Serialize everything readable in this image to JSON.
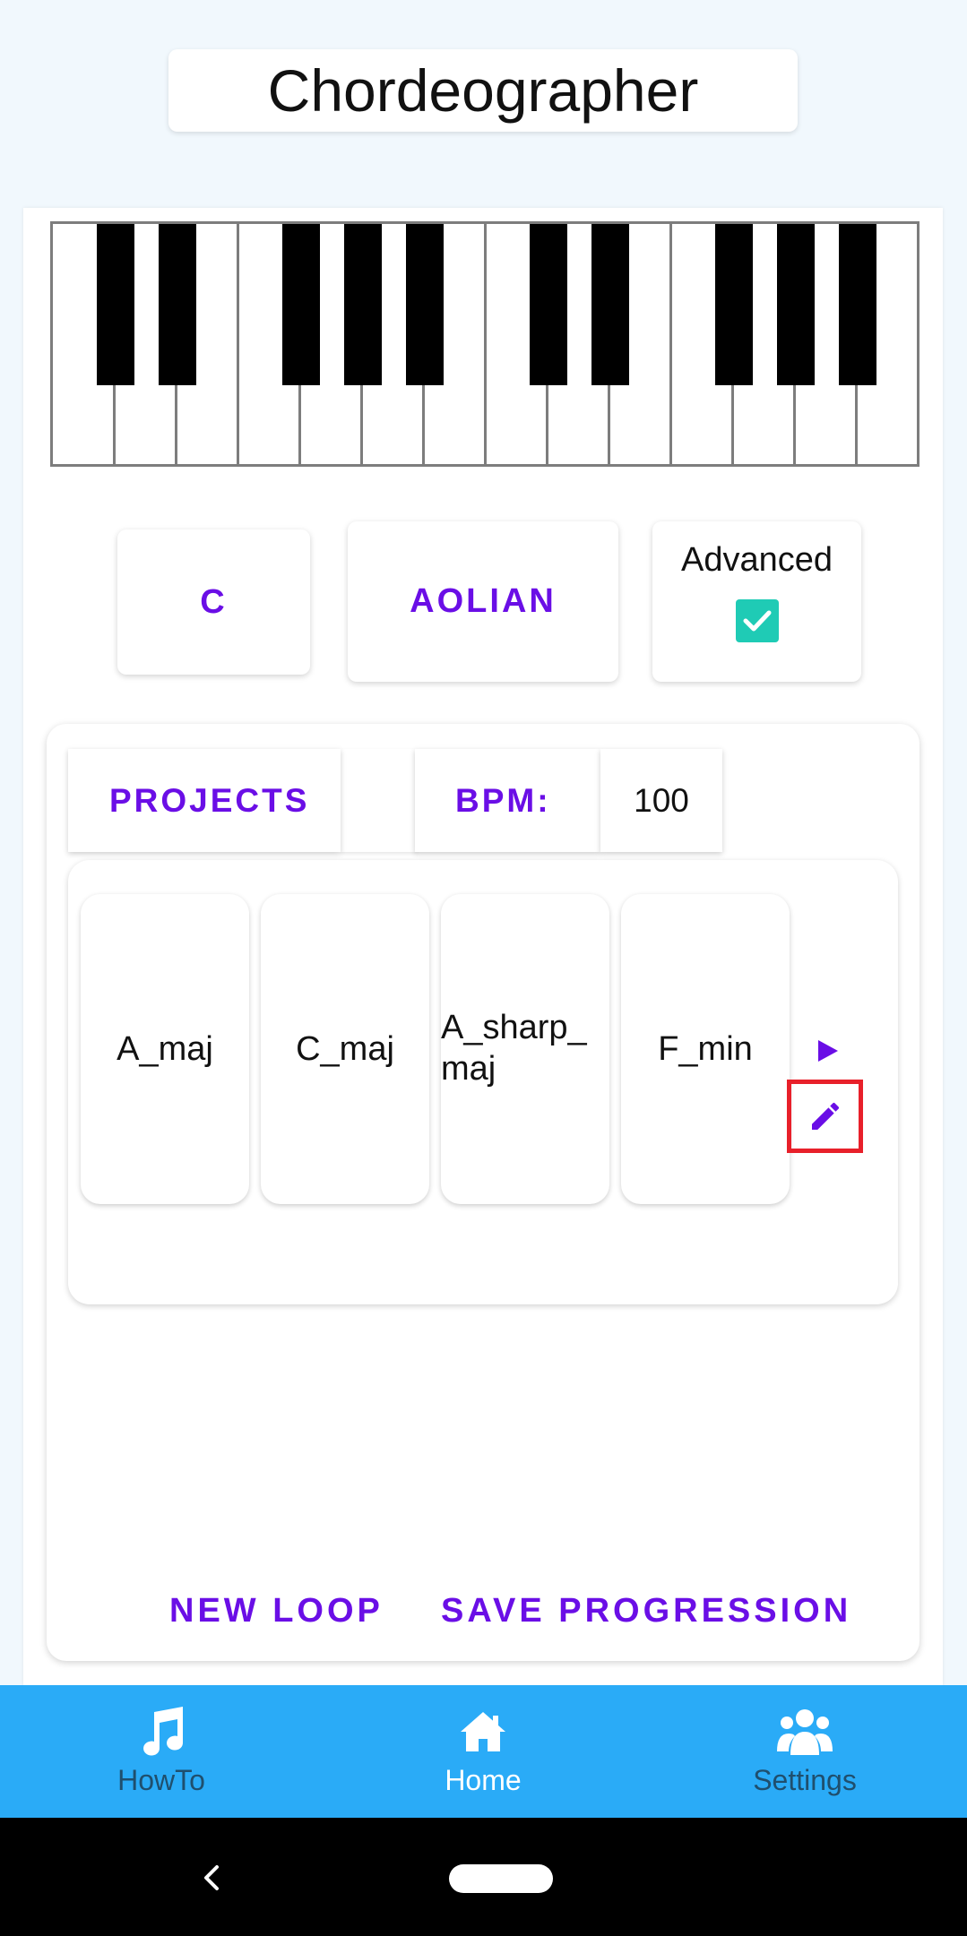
{
  "app": {
    "title": "Chordeographer"
  },
  "controls": {
    "key_label": "C",
    "mode_label": "AOLIAN",
    "advanced_label": "Advanced",
    "advanced_checked": true
  },
  "tabs": {
    "projects_label": "PROJECTS",
    "bpm_label": "BPM:",
    "bpm_value": "100"
  },
  "chords": [
    {
      "label": "A_maj"
    },
    {
      "label": "C_maj"
    },
    {
      "label": "A_sharp_\nmaj"
    },
    {
      "label": "F_min"
    }
  ],
  "actions": {
    "new_loop_label": "NEW LOOP",
    "save_progression_label": "SAVE PROGRESSION"
  },
  "nav": {
    "items": [
      {
        "label": "HowTo",
        "icon": "music-note-icon",
        "active": false
      },
      {
        "label": "Home",
        "icon": "home-icon",
        "active": true
      },
      {
        "label": "Settings",
        "icon": "users-icon",
        "active": false
      }
    ]
  },
  "colors": {
    "accent": "#6a0ee6",
    "nav_bg": "#2aabf7",
    "checkbox": "#1fcbb5",
    "highlight_border": "#e8202a",
    "nav_inactive_text": "#1f4f6e",
    "nav_active_text": "#ffffff"
  }
}
